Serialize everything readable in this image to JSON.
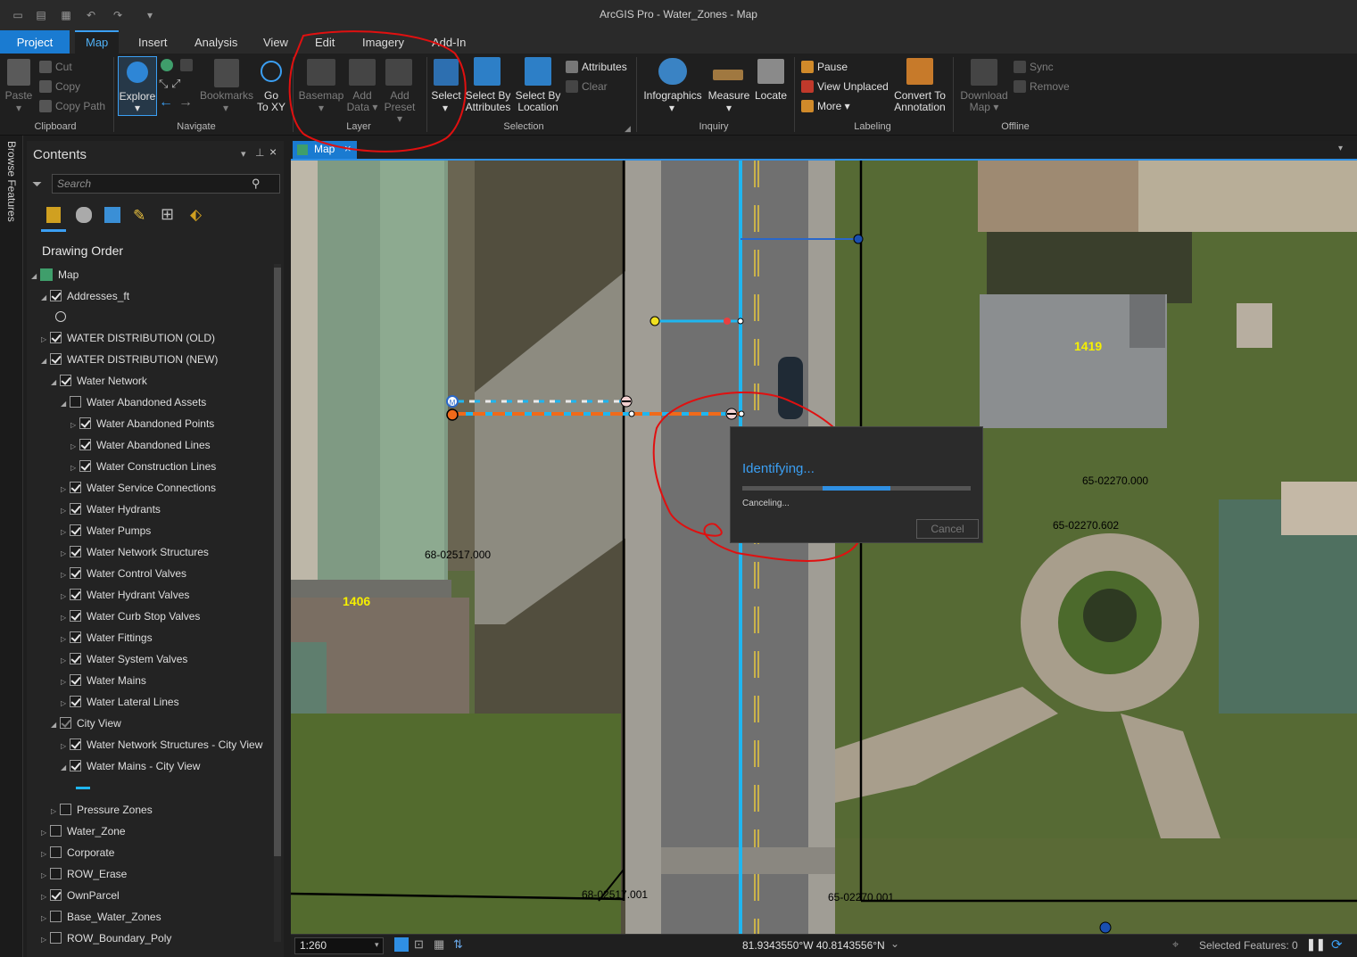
{
  "app": {
    "title": "ArcGIS Pro - Water_Zones - Map"
  },
  "tabs": [
    "Project",
    "Map",
    "Insert",
    "Analysis",
    "View",
    "Edit",
    "Imagery",
    "Add-In"
  ],
  "ribbon": {
    "clipboard": {
      "label": "Clipboard",
      "paste": "Paste",
      "cut": "Cut",
      "copy": "Copy",
      "copy_path": "Copy Path"
    },
    "navigate": {
      "label": "Navigate",
      "explore": "Explore",
      "bookmarks": "Bookmarks",
      "go": "Go",
      "to_xy": "To XY"
    },
    "layer": {
      "label": "Layer",
      "basemap": "Basemap",
      "add": "Add",
      "data": "Data",
      "add2": "Add",
      "preset": "Preset"
    },
    "selection": {
      "label": "Selection",
      "select": "Select",
      "select_by": "Select By",
      "attributes": "Attributes",
      "select_by2": "Select By",
      "location": "Location",
      "attributes_btn": "Attributes",
      "clear": "Clear"
    },
    "inquiry": {
      "label": "Inquiry",
      "infographics": "Infographics",
      "measure": "Measure",
      "locate": "Locate"
    },
    "labeling": {
      "label": "Labeling",
      "pause": "Pause",
      "view_unplaced": "View Unplaced",
      "more": "More",
      "convert_to": "Convert To",
      "annotation": "Annotation"
    },
    "offline": {
      "label": "Offline",
      "download": "Download",
      "map": "Map",
      "sync": "Sync",
      "remove": "Remove"
    }
  },
  "sidebar_strip": {
    "label": "Browse Features"
  },
  "contents": {
    "title": "Contents",
    "search_placeholder": "Search",
    "drawing_order": "Drawing Order",
    "map": "Map",
    "layers": [
      {
        "label": "Addresses_ft",
        "checked": true
      },
      {
        "label": "WATER DISTRIBUTION (OLD)",
        "checked": true
      },
      {
        "label": "WATER DISTRIBUTION (NEW)",
        "checked": true
      },
      {
        "label": "Water Network",
        "checked": true
      },
      {
        "label": "Water Abandoned Assets",
        "checked": false
      },
      {
        "label": "Water Abandoned Points",
        "checked": true
      },
      {
        "label": "Water Abandoned Lines",
        "checked": true
      },
      {
        "label": "Water Construction Lines",
        "checked": true
      },
      {
        "label": "Water Service Connections",
        "checked": true
      },
      {
        "label": "Water Hydrants",
        "checked": true
      },
      {
        "label": "Water Pumps",
        "checked": true
      },
      {
        "label": "Water Network Structures",
        "checked": true
      },
      {
        "label": "Water Control Valves",
        "checked": true
      },
      {
        "label": "Water Hydrant Valves",
        "checked": true
      },
      {
        "label": "Water Curb Stop Valves",
        "checked": true
      },
      {
        "label": "Water Fittings",
        "checked": true
      },
      {
        "label": "Water System Valves",
        "checked": true
      },
      {
        "label": "Water Mains",
        "checked": true
      },
      {
        "label": "Water Lateral Lines",
        "checked": true
      },
      {
        "label": "City View",
        "checked": true
      },
      {
        "label": "Water Network Structures - City View",
        "checked": true
      },
      {
        "label": "Water Mains - City View",
        "checked": true
      },
      {
        "label": "Pressure Zones",
        "checked": false
      },
      {
        "label": "Water_Zone",
        "checked": false
      },
      {
        "label": "Corporate",
        "checked": false
      },
      {
        "label": "ROW_Erase",
        "checked": false
      },
      {
        "label": "OwnParcel",
        "checked": true
      },
      {
        "label": "Base_Water_Zones",
        "checked": false
      },
      {
        "label": "ROW_Boundary_Poly",
        "checked": false
      }
    ]
  },
  "map_view": {
    "tab_label": "Map",
    "labels": {
      "addr_1419": "1419",
      "addr_1406": "1406",
      "parcel_a": "68-02517.000",
      "parcel_b": "65-02270.000",
      "parcel_c": "65-02270.602",
      "parcel_d": "68-02517.001",
      "parcel_e": "65-02270.001"
    }
  },
  "dialog": {
    "title": "Identifying...",
    "status": "Canceling...",
    "cancel": "Cancel",
    "progress": 0.6
  },
  "statusbar": {
    "scale": "1:260",
    "coords": "81.9343550°W 40.8143556°N",
    "selected": "Selected Features: 0"
  },
  "colors": {
    "accent": "#1a7bd1",
    "annotation": "#e01010",
    "water_main": "#1fb6f0",
    "label_yellow": "#f5f000"
  }
}
